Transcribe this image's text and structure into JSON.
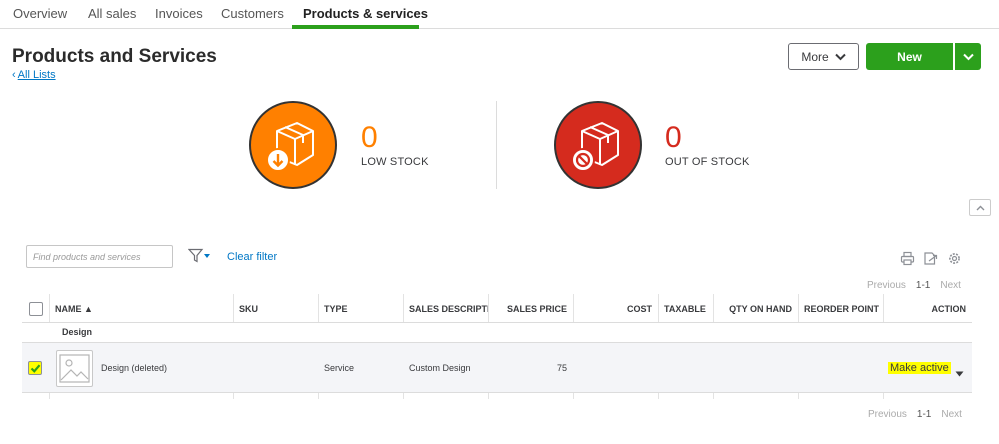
{
  "tabs": [
    {
      "label": "Overview"
    },
    {
      "label": "All sales"
    },
    {
      "label": "Invoices"
    },
    {
      "label": "Customers"
    },
    {
      "label": "Products & services"
    }
  ],
  "active_tab": "Products & services",
  "page": {
    "title": "Products and Services",
    "back_link": "All Lists"
  },
  "buttons": {
    "more": "More",
    "new": "New"
  },
  "stock": {
    "low": {
      "count": "0",
      "label": "LOW STOCK",
      "color": "#ff8000"
    },
    "out": {
      "count": "0",
      "label": "OUT OF STOCK",
      "color": "#d52b1e"
    }
  },
  "toolbar": {
    "search_placeholder": "Find products and services",
    "clear_filter": "Clear filter",
    "icons": [
      "printer-icon",
      "export-icon",
      "settings-icon"
    ]
  },
  "pager_top": {
    "previous": "Previous",
    "range": "1-1",
    "next": "Next"
  },
  "pager_bottom": {
    "previous": "Previous",
    "range": "1-1",
    "next": "Next"
  },
  "table": {
    "columns": [
      "NAME ▲",
      "SKU",
      "TYPE",
      "SALES DESCRIPTION",
      "SALES PRICE",
      "COST",
      "TAXABLE",
      "QTY ON HAND",
      "REORDER POINT",
      "ACTION"
    ],
    "group": "Design",
    "rows": [
      {
        "checked": true,
        "name": "Design (deleted)",
        "sku": "",
        "type": "Service",
        "sales_description": "Custom Design",
        "sales_price": "75",
        "cost": "",
        "taxable": "",
        "qty_on_hand": "",
        "reorder_point": "",
        "action": "Make active"
      }
    ]
  },
  "colors": {
    "brand_green": "#2ca01c",
    "link_blue": "#0077c5",
    "highlight": "#ffff00"
  }
}
